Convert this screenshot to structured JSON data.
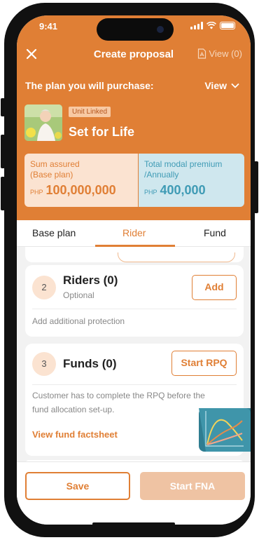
{
  "status_bar": {
    "time": "9:41"
  },
  "nav": {
    "title": "Create proposal",
    "view_label": "View (0)",
    "icons": [
      "close-icon",
      "pdf-icon"
    ]
  },
  "plan": {
    "label": "The plan you will purchase:",
    "view_label": "View",
    "badge": "Unit Linked",
    "name": "Set for Life",
    "sum_assured": {
      "label_line1": "Sum assured",
      "label_line2": "(Base plan)",
      "currency": "PHP",
      "amount": "100,000,000"
    },
    "premium": {
      "label_line1": "Total modal premium",
      "label_line2": "/Annually",
      "currency": "PHP",
      "amount": "400,000"
    }
  },
  "tabs": [
    {
      "label": "Base plan",
      "active": false
    },
    {
      "label": "Rider",
      "active": true
    },
    {
      "label": "Fund",
      "active": false
    }
  ],
  "riders_card": {
    "number": "2",
    "title": "Riders (0)",
    "subtitle": "Optional",
    "button": "Add",
    "description": "Add additional protection"
  },
  "funds_card": {
    "number": "3",
    "title": "Funds (0)",
    "button": "Start RPQ",
    "description_line1": "Customer has to complete the RPQ before the",
    "description_line2": "fund allocation set-up.",
    "link": "View fund factsheet"
  },
  "footer": {
    "save_label": "Save",
    "start_fna_label": "Start FNA"
  },
  "colors": {
    "primary": "#e07f35",
    "teal": "#3f9bb5",
    "light_orange": "#fbe3d1",
    "light_teal": "#cfe7ee",
    "disabled_button": "#efc3a3"
  }
}
